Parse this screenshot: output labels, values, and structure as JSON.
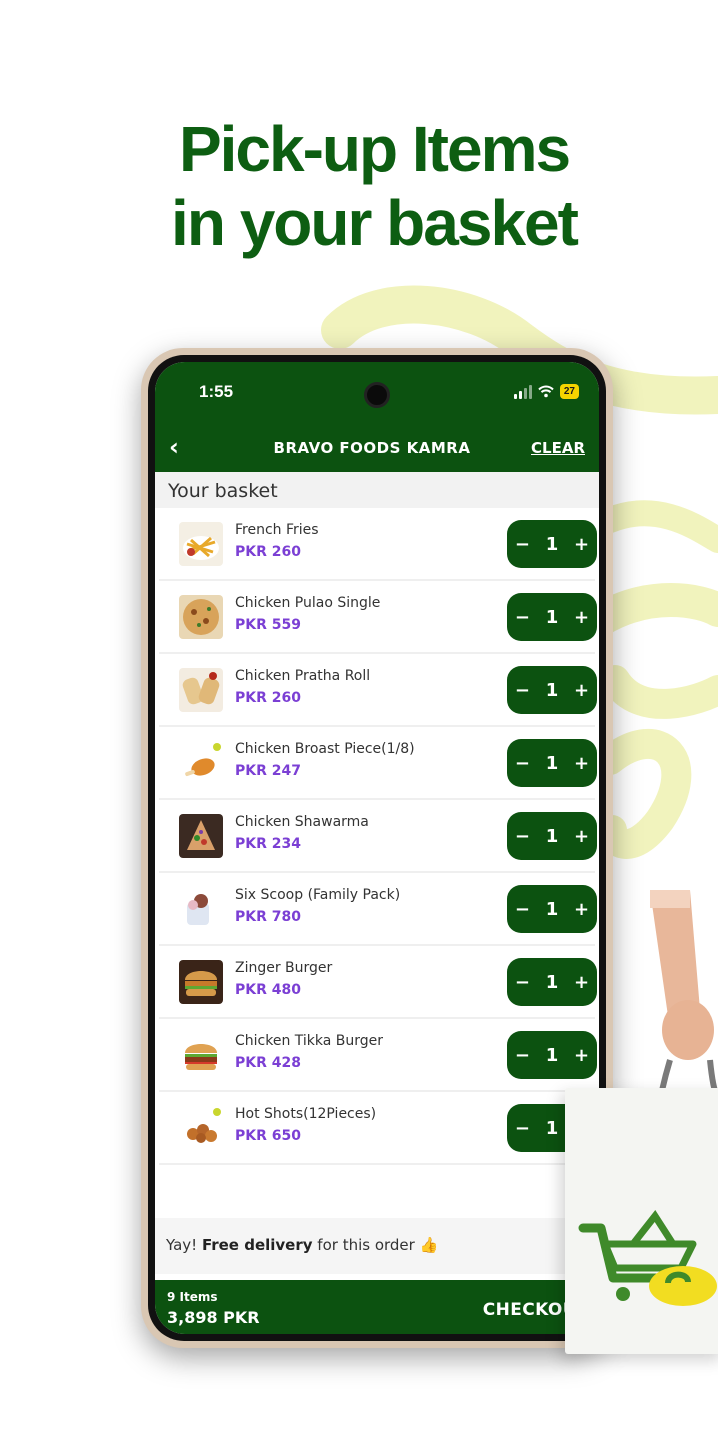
{
  "headline": {
    "line1": "Pick-up Items",
    "line2": "in your basket"
  },
  "status_bar": {
    "time": "1:55",
    "battery": "27"
  },
  "header": {
    "back_icon": "chevron-left-icon",
    "store_name": "BRAVO FOODS KAMRA",
    "clear_label": "CLEAR"
  },
  "basket": {
    "title": "Your basket",
    "items": [
      {
        "name": "French Fries",
        "price": "PKR 260",
        "qty": "1",
        "image": "fries"
      },
      {
        "name": "Chicken Pulao Single",
        "price": "PKR 559",
        "qty": "1",
        "image": "pulao"
      },
      {
        "name": "Chicken Pratha Roll",
        "price": "PKR 260",
        "qty": "1",
        "image": "roll"
      },
      {
        "name": "Chicken Broast Piece(1/8)",
        "price": "PKR 247",
        "qty": "1",
        "image": "broast"
      },
      {
        "name": "Chicken Shawarma",
        "price": "PKR 234",
        "qty": "1",
        "image": "shawarma"
      },
      {
        "name": "Six Scoop (Family Pack)",
        "price": "PKR 780",
        "qty": "1",
        "image": "icecream"
      },
      {
        "name": "Zinger Burger",
        "price": "PKR 480",
        "qty": "1",
        "image": "burger"
      },
      {
        "name": "Chicken Tikka Burger",
        "price": "PKR 428",
        "qty": "1",
        "image": "burger2"
      },
      {
        "name": "Hot Shots(12Pieces)",
        "price": "PKR 650",
        "qty": "1",
        "image": "hotshots"
      }
    ],
    "stepper": {
      "minus": "−",
      "plus": "+"
    }
  },
  "free_delivery": {
    "prefix": "Yay! ",
    "highlight": "Free delivery",
    "suffix": " for this order",
    "emoji": "👍"
  },
  "checkout_bar": {
    "item_count": "9 Items",
    "total": "3,898 PKR",
    "checkout_label": "CHECKOUT"
  },
  "colors": {
    "brand_green": "#0c5210",
    "headline_green": "#0d5e12",
    "price_purple": "#7b3fd4",
    "accent_yellow": "#eef2b0"
  }
}
